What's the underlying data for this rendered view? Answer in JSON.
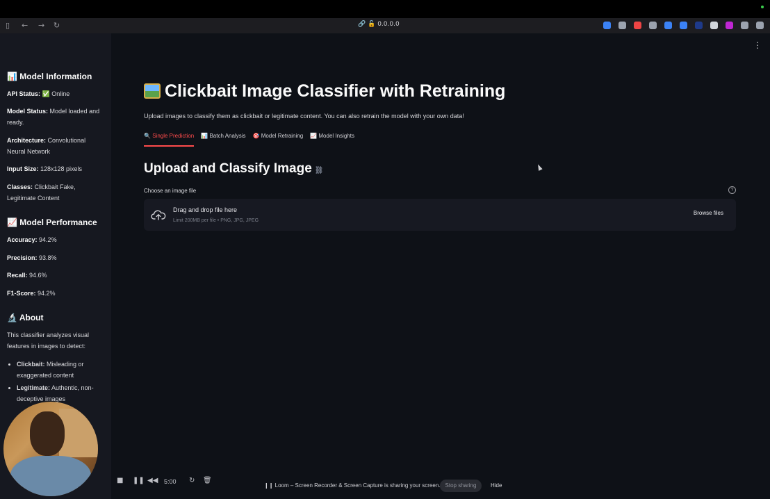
{
  "browser": {
    "address": "0.0.0.0",
    "extension_colors": [
      "#3b82f6",
      "#9ca3af",
      "#ef4444",
      "#9ca3af",
      "#3b82f6",
      "#3b82f6",
      "#1e3a8a",
      "#d1d5db",
      "#c026d3",
      "#9ca3af",
      "#9ca3af"
    ]
  },
  "sidebar": {
    "model_info": {
      "icon": "📊",
      "title": "Model Information",
      "api_status_label": "API Status:",
      "api_status_icon": "✅",
      "api_status_value": "Online",
      "model_status_label": "Model Status:",
      "model_status_value": "Model loaded and ready.",
      "architecture_label": "Architecture:",
      "architecture_value": "Convolutional Neural Network",
      "input_size_label": "Input Size:",
      "input_size_value": "128x128 pixels",
      "classes_label": "Classes:",
      "classes_value": "Clickbait Fake, Legitimate Content"
    },
    "performance": {
      "icon": "📈",
      "title": "Model Performance",
      "accuracy_label": "Accuracy:",
      "accuracy_value": "94.2%",
      "precision_label": "Precision:",
      "precision_value": "93.8%",
      "recall_label": "Recall:",
      "recall_value": "94.6%",
      "f1_label": "F1-Score:",
      "f1_value": "94.2%"
    },
    "about": {
      "icon": "🔬",
      "title": "About",
      "text": "This classifier analyzes visual features in images to detect:",
      "items": [
        {
          "label": "Clickbait:",
          "text": "Misleading or exaggerated content"
        },
        {
          "label": "Legitimate:",
          "text": "Authentic, non-deceptive images"
        }
      ]
    }
  },
  "main": {
    "title": "Clickbait Image Classifier with Retraining",
    "subtitle": "Upload images to classify them as clickbait or legitimate content. You can also retrain the model with your own data!",
    "tabs": [
      {
        "icon": "🔍",
        "label": "Single Prediction",
        "active": true
      },
      {
        "icon": "📊",
        "label": "Batch Analysis",
        "active": false
      },
      {
        "icon": "🎯",
        "label": "Model Retraining",
        "active": false
      },
      {
        "icon": "📈",
        "label": "Model Insights",
        "active": false
      }
    ],
    "section_title": "Upload and Classify Image",
    "uploader": {
      "label": "Choose an image file",
      "drag_text": "Drag and drop file here",
      "limit_text": "Limit 200MB per file • PNG, JPG, JPEG",
      "browse_label": "Browse files"
    }
  },
  "recorder": {
    "time": "5:00",
    "share_message": "Loom – Screen Recorder & Screen Capture is sharing your screen.",
    "stop_label": "Stop sharing",
    "hide_label": "Hide"
  }
}
